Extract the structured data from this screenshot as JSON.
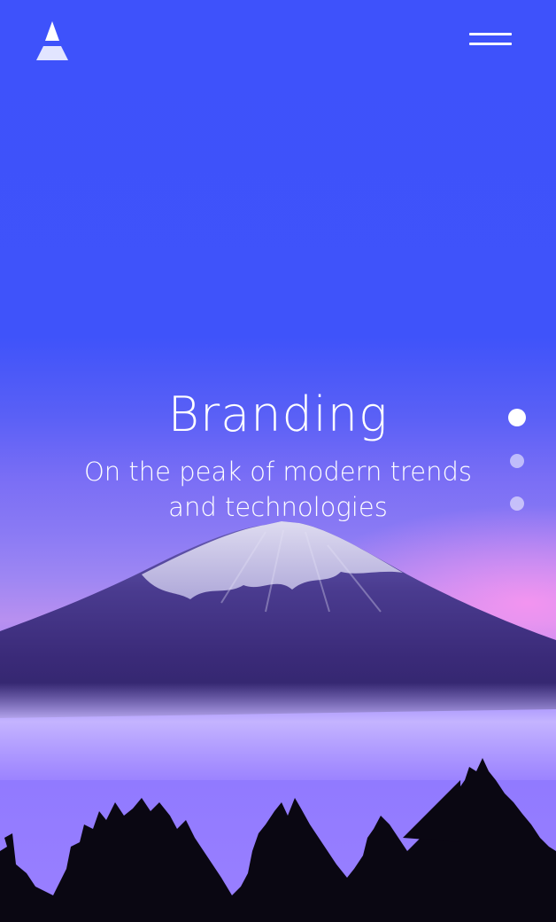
{
  "header": {
    "logo_icon": "mountain-logo-icon",
    "menu_icon": "hamburger-menu-icon"
  },
  "hero": {
    "title": "Branding",
    "subtitle_line1": "On the peak of modern trends",
    "subtitle_line2": "and technologies",
    "background_image": "mount-fuji-at-dusk"
  },
  "pagination": {
    "count": 3,
    "active_index": 0
  },
  "colors": {
    "accent": "#3f53fa",
    "text": "#ffffff"
  }
}
